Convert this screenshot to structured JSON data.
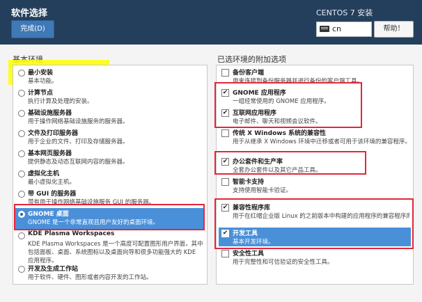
{
  "header": {
    "title": "软件选择",
    "done_label": "完成(D)",
    "product": "CENTOS 7 安装",
    "keyboard_layout": "cn",
    "help_label": "帮助！"
  },
  "base_environment": {
    "heading": "基本环境",
    "items": [
      {
        "name": "最小安装",
        "desc": "基本功能。"
      },
      {
        "name": "计算节点",
        "desc": "执行计算及处理的安装。"
      },
      {
        "name": "基础设施服务器",
        "desc": "用于操作网络基础设施服务的服务器。"
      },
      {
        "name": "文件及打印服务器",
        "desc": "用于企业的文件、打印及存储服务器。"
      },
      {
        "name": "基本网页服务器",
        "desc": "提供静态及动态互联网内容的服务器。"
      },
      {
        "name": "虚拟化主机",
        "desc": "最小虚拟化主机。"
      },
      {
        "name": "带 GUI 的服务器",
        "desc": "带有用于操作网络基础设施服务 GUI 的服务器。"
      },
      {
        "name": "GNOME 桌面",
        "desc": "GNOME 是一个非常直观且用户友好的桌面环境。"
      },
      {
        "name": "KDE Plasma Workspaces",
        "desc": "KDE Plasma Workspaces 是一个高度可配置图形用户界面，其中包括面板、桌面、系统图标以及桌面向导和很多功能强大的 KDE 应用程序。"
      },
      {
        "name": "开发及生成工作站",
        "desc": "用于软件、硬件、图形或者内容开发的工作站。"
      }
    ]
  },
  "addons": {
    "heading": "已选环境的附加选项",
    "items": [
      {
        "name": "备份客户端",
        "desc": "用来连接到备份服务器并进行备份的客户端工具。",
        "checked": false
      },
      {
        "name": "GNOME 应用程序",
        "desc": "一组经常使用的 GNOME 应用程序。",
        "checked": true
      },
      {
        "name": "互联网应用程序",
        "desc": "电子邮件、聊天和视频会议软件。",
        "checked": true
      },
      {
        "name": "传统 X Windows 系统的兼容性",
        "desc": "用于从继承 X Windows 环境中迁移或者可用于该环境的兼容程序。",
        "checked": false
      },
      {
        "name": "办公套件和生产率",
        "desc": "全套办公套件以及其它产品工具。",
        "checked": true
      },
      {
        "name": "智能卡支持",
        "desc": "支持使用智能卡验证。",
        "checked": false
      },
      {
        "name": "兼容性程序库",
        "desc": "用于在红帽企业版 Linux 的之前版本中构建的应用程序的兼容程序库。",
        "checked": true
      },
      {
        "name": "开发工具",
        "desc": "基本开发环境。",
        "checked": true
      },
      {
        "name": "安全性工具",
        "desc": "用于完整性和可信验证的安全性工具。",
        "checked": false
      }
    ]
  },
  "colors": {
    "header_bg": "#243f5c",
    "selection": "#4a90d9",
    "highlight_box": "#e3263a",
    "highlight_marker": "#ffff00"
  }
}
